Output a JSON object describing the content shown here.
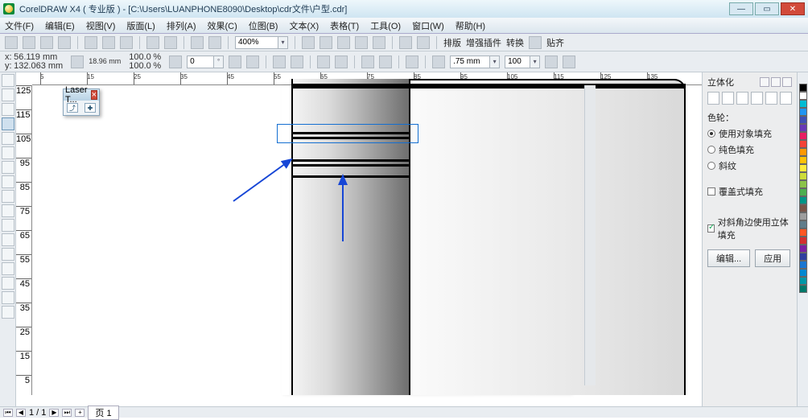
{
  "title": "CorelDRAW X4 ( 专业版 ) - [C:\\Users\\LUANPHONE8090\\Desktop\\cdr文件\\户型.cdr]",
  "menu": [
    "文件(F)",
    "编辑(E)",
    "视图(V)",
    "版面(L)",
    "排列(A)",
    "效果(C)",
    "位图(B)",
    "文本(X)",
    "表格(T)",
    "工具(O)",
    "窗口(W)",
    "帮助(H)"
  ],
  "toolbar1": {
    "zoom": "400%",
    "group1_labels": [
      "排版",
      "增强插件",
      "转换",
      "贴齐"
    ]
  },
  "propbar": {
    "x_label": "x:",
    "y_label": "y:",
    "x": "56.119 mm",
    "y": "132.063 mm",
    "w": "18.96 mm",
    "h": "",
    "scale_x": "100.0",
    "scale_y": "100.0",
    "percent": "%",
    "angle": "0",
    "deg": "°",
    "outline": ".75 mm",
    "copies": "100"
  },
  "laser": {
    "title": "Laser T...",
    "close": "×"
  },
  "ruler_marks_h": [
    5,
    15,
    25,
    35,
    45,
    55,
    65,
    75,
    85,
    95,
    105,
    115,
    125,
    135
  ],
  "ruler_marks_v": [
    125,
    115,
    105,
    95,
    85,
    75,
    65,
    55,
    45,
    35,
    25,
    15,
    5
  ],
  "docker": {
    "title": "立体化",
    "section": "色轮：",
    "opt1": "使用对象填充",
    "opt2": "纯色填充",
    "opt3": "斜纹",
    "opt4": "覆盖式填充",
    "opt5": "对斜角边使用立体填充",
    "btn_edit": "编辑...",
    "btn_apply": "应用"
  },
  "colors": [
    "#000000",
    "#ffffff",
    "#00bcd4",
    "#2196f3",
    "#3f51b5",
    "#673ab7",
    "#e91e63",
    "#f44336",
    "#ff9800",
    "#ffc107",
    "#ffeb3b",
    "#cddc39",
    "#8bc34a",
    "#4caf50",
    "#009688",
    "#795548",
    "#9e9e9e",
    "#607d8b",
    "#ff5722",
    "#d32f2f",
    "#7b1fa2",
    "#303f9f",
    "#1976d2",
    "#0288d1",
    "#0097a7",
    "#00796b"
  ],
  "status": {
    "page_info": "1 / 1",
    "page_tab": "页 1"
  }
}
